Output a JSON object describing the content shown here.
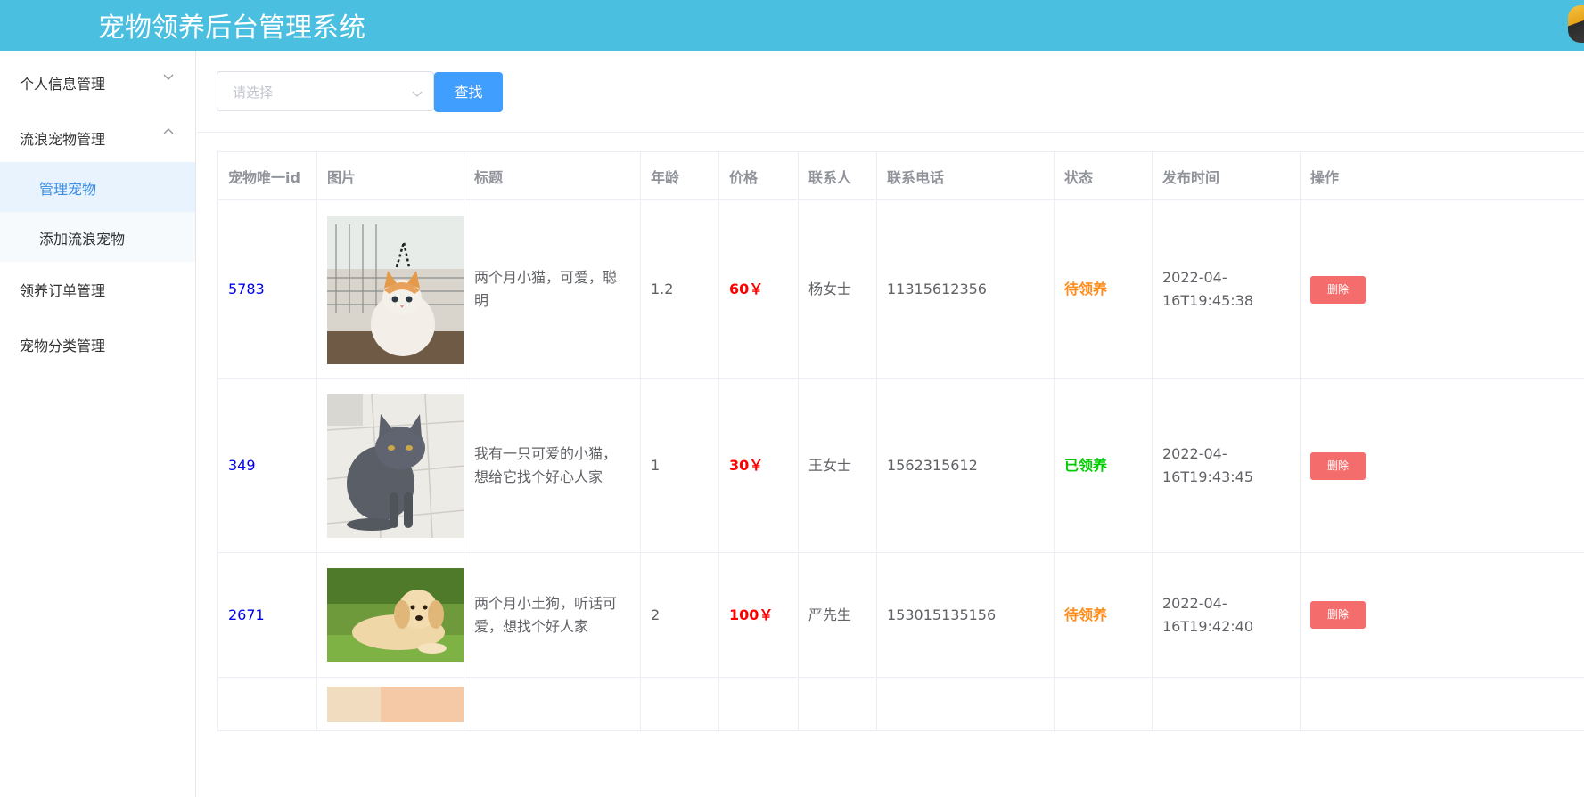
{
  "header": {
    "title": "宠物领养后台管理系统"
  },
  "sidebar": {
    "menus": [
      {
        "label": "个人信息管理",
        "expanded": false
      },
      {
        "label": "流浪宠物管理",
        "expanded": true
      },
      {
        "label": "领养订单管理"
      },
      {
        "label": "宠物分类管理"
      }
    ],
    "submenu": [
      {
        "label": "管理宠物",
        "active": true
      },
      {
        "label": "添加流浪宠物",
        "active": false
      }
    ]
  },
  "toolbar": {
    "select_placeholder": "请选择",
    "search_label": "查找"
  },
  "table": {
    "headers": [
      "宠物唯一id",
      "图片",
      "标题",
      "年龄",
      "价格",
      "联系人",
      "联系电话",
      "状态",
      "发布时间",
      "操作"
    ],
    "rows": [
      {
        "id": "5783",
        "image": "kitten-orange-white",
        "title": "两个月小猫，可爱，聪明",
        "age": "1.2",
        "price": "60￥",
        "contact": "杨女士",
        "phone": "11315612356",
        "status": "待领养",
        "time": "2022-04-16T19:45:38",
        "action": "删除"
      },
      {
        "id": "349",
        "image": "grey-cat",
        "title": "我有一只可爱的小猫，想给它找个好心人家",
        "age": "1",
        "price": "30￥",
        "contact": "王女士",
        "phone": "1562315612",
        "status": "已领养",
        "time": "2022-04-16T19:43:45",
        "action": "删除"
      },
      {
        "id": "2671",
        "image": "golden-puppy",
        "title": "两个月小土狗，听话可爱，想找个好人家",
        "age": "2",
        "price": "100￥",
        "contact": "严先生",
        "phone": "153015135156",
        "status": "待领养",
        "time": "2022-04-16T19:42:40",
        "action": "删除"
      }
    ]
  },
  "colors": {
    "header_bg": "#4bbfe0",
    "primary": "#409eff",
    "danger": "#f56c6c",
    "status_wait": "#ff8c1a",
    "status_done": "#00cc00"
  }
}
